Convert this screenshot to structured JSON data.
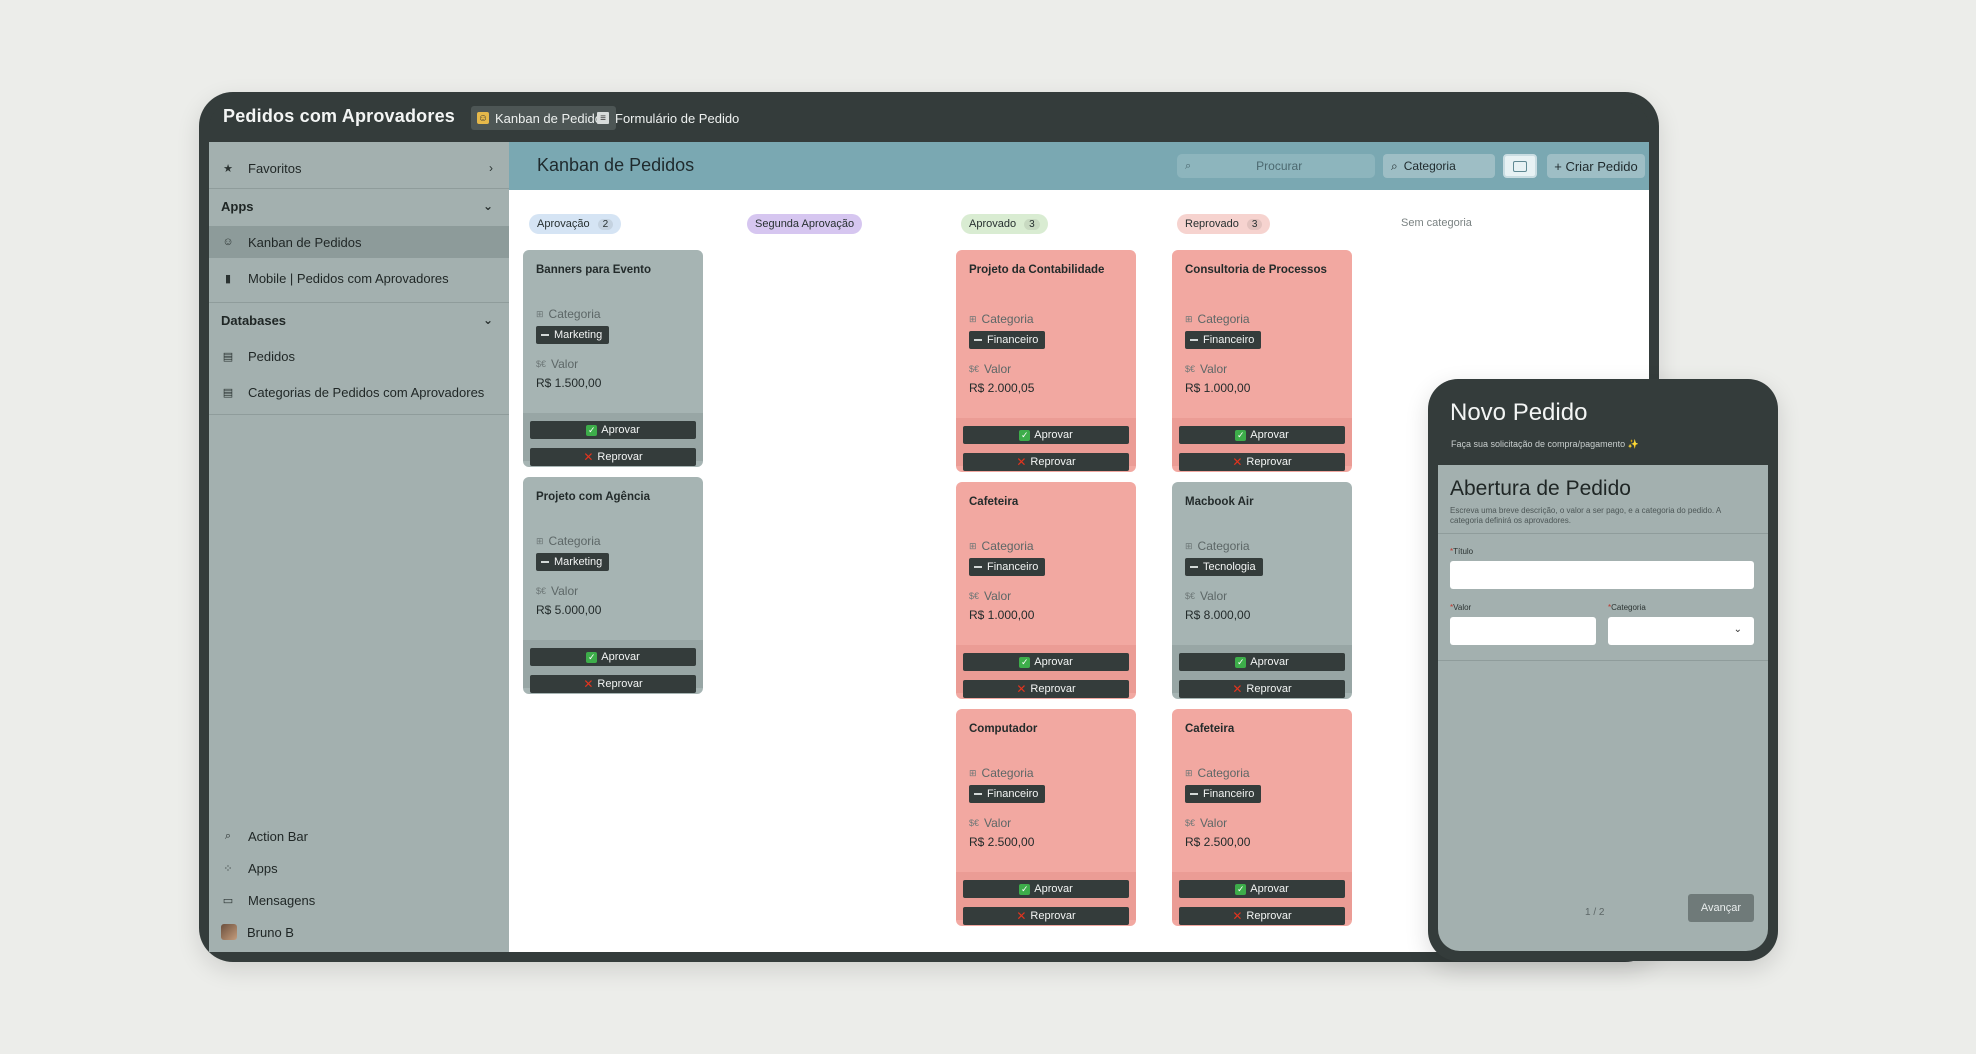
{
  "app": {
    "title": "Pedidos com Aprovadores",
    "tabs": [
      {
        "label": "Kanban de Pedidos"
      },
      {
        "label": "Formulário de Pedido"
      }
    ]
  },
  "sidebar": {
    "favorites": "Favoritos",
    "apps_header": "Apps",
    "apps": [
      "Kanban de Pedidos",
      "Mobile | Pedidos com Aprovadores"
    ],
    "databases_header": "Databases",
    "databases": [
      "Pedidos",
      "Categorias de Pedidos com Aprovadores"
    ],
    "bottom": [
      "Action Bar",
      "Apps",
      "Mensagens",
      "Bruno B"
    ]
  },
  "main": {
    "title": "Kanban de Pedidos",
    "search_placeholder": "Procurar",
    "category_button": "Categoria",
    "new_button": "+ Criar Pedido"
  },
  "columns": [
    {
      "label": "Aprovação",
      "count": "2",
      "color": "#d5e4f4"
    },
    {
      "label": "Segunda Aprovação",
      "count": "",
      "color": "#d6c6f0"
    },
    {
      "label": "Aprovado",
      "count": "3",
      "color": "#d9ecd2"
    },
    {
      "label": "Reprovado",
      "count": "3",
      "color": "#f6d3cf"
    },
    {
      "label": "Sem categoria",
      "count": ""
    }
  ],
  "card_labels": {
    "category": "Categoria",
    "value": "Valor",
    "approve": "Aprovar",
    "reject": "Reprovar"
  },
  "cards": [
    {
      "title": "Banners para Evento",
      "category": "Marketing",
      "value": "R$ 1.500,00"
    },
    {
      "title": "Projeto com Agência",
      "category": "Marketing",
      "value": "R$ 5.000,00"
    },
    {
      "title": "Projeto da Contabilidade",
      "category": "Financeiro",
      "value": "R$ 2.000,05"
    },
    {
      "title": "Cafeteira",
      "category": "Financeiro",
      "value": "R$ 1.000,00"
    },
    {
      "title": "Computador",
      "category": "Financeiro",
      "value": "R$ 2.500,00"
    },
    {
      "title": "Consultoria de Processos",
      "category": "Financeiro",
      "value": "R$ 1.000,00"
    },
    {
      "title": "Macbook Air",
      "category": "Tecnologia",
      "value": "R$ 8.000,00"
    },
    {
      "title": "Cafeteira",
      "category": "Financeiro",
      "value": "R$ 2.500,00"
    }
  ],
  "phone": {
    "title": "Novo Pedido",
    "subtitle": "Faça sua solicitação de compra/pagamento ✨",
    "form_title": "Abertura de Pedido",
    "form_desc": "Escreva uma breve descrição, o valor a ser pago, e a categoria do pedido. A categoria definirá os aprovadores.",
    "field_title": "Título",
    "field_value": "Valor",
    "field_category": "Categoria",
    "required_mark": "*",
    "page": "1 / 2",
    "next_button": "Avançar"
  }
}
